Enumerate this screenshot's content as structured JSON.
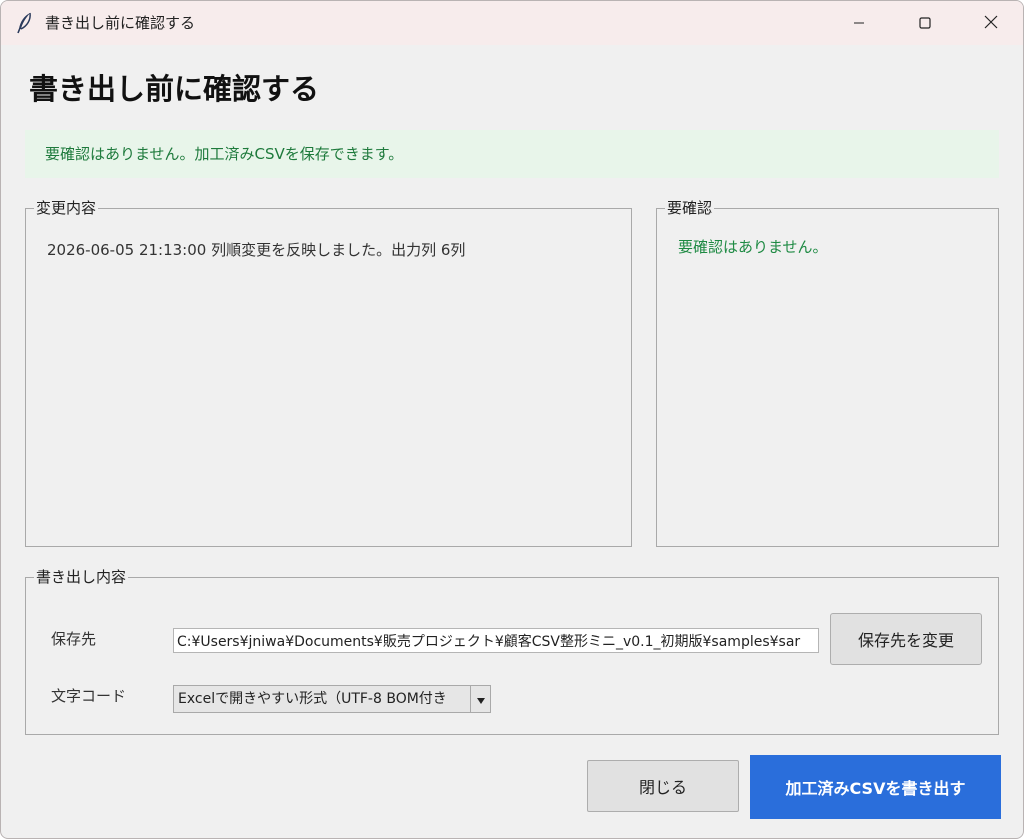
{
  "window": {
    "title": "書き出し前に確認する"
  },
  "page": {
    "title": "書き出し前に確認する",
    "banner": "要確認はありません。加工済みCSVを保存できます。"
  },
  "changes": {
    "legend": "変更内容",
    "items": [
      "2026-06-05 21:13:00 列順変更を反映しました。出力列 6列"
    ]
  },
  "warnings": {
    "legend": "要確認",
    "items": [
      "要確認はありません。"
    ]
  },
  "export": {
    "legend": "書き出し内容",
    "path_label": "保存先",
    "path_value": "C:¥Users¥jniwa¥Documents¥販売プロジェクト¥顧客CSV整形ミニ_v0.1_初期版¥samples¥sar",
    "change_dest_label": "保存先を変更",
    "encoding_label": "文字コード",
    "encoding_value": "Excelで開きやすい形式（UTF-8 BOM付き"
  },
  "actions": {
    "close_label": "閉じる",
    "export_label": "加工済みCSVを書き出す"
  },
  "colors": {
    "accent": "#2a6edb",
    "success_text": "#1e7a3c",
    "success_bg": "#e8f5ea"
  }
}
